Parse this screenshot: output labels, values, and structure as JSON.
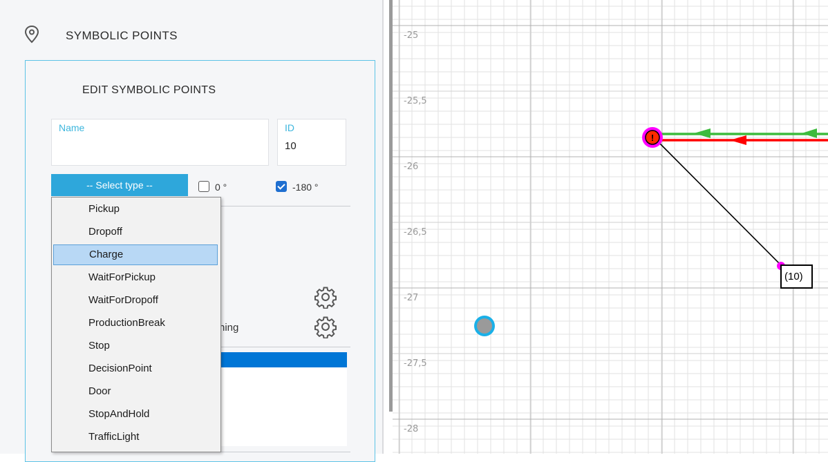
{
  "panel": {
    "title": "SYMBOLIC POINTS",
    "edit_title": "EDIT SYMBOLIC POINTS",
    "name_label": "Name",
    "name_value": "",
    "id_label": "ID",
    "id_value": "10",
    "select_label": "-- Select type --",
    "checkbox_0": {
      "label": "0 °",
      "checked": false
    },
    "checkbox_180": {
      "label": "-180 °",
      "checked": true
    },
    "partial_label": "ning"
  },
  "dropdown": {
    "selected": "Charge",
    "options": [
      "Pickup",
      "Dropoff",
      "Charge",
      "WaitForPickup",
      "WaitForDropoff",
      "ProductionBreak",
      "Stop",
      "DecisionPoint",
      "Door",
      "StopAndHold",
      "TrafficLight"
    ]
  },
  "map": {
    "y_labels": [
      "-25",
      "-25,5",
      "-26",
      "-26,5",
      "-27",
      "-27,5",
      "-28"
    ],
    "point_label": "(10)",
    "warning_glyph": "!",
    "colors": {
      "green_path": "#3dbb3d",
      "red_path": "#ff0000",
      "point_magenta": "#ff00ff",
      "node_cyan": "#1ab0e8",
      "node_gray": "#9a9a9a"
    }
  }
}
